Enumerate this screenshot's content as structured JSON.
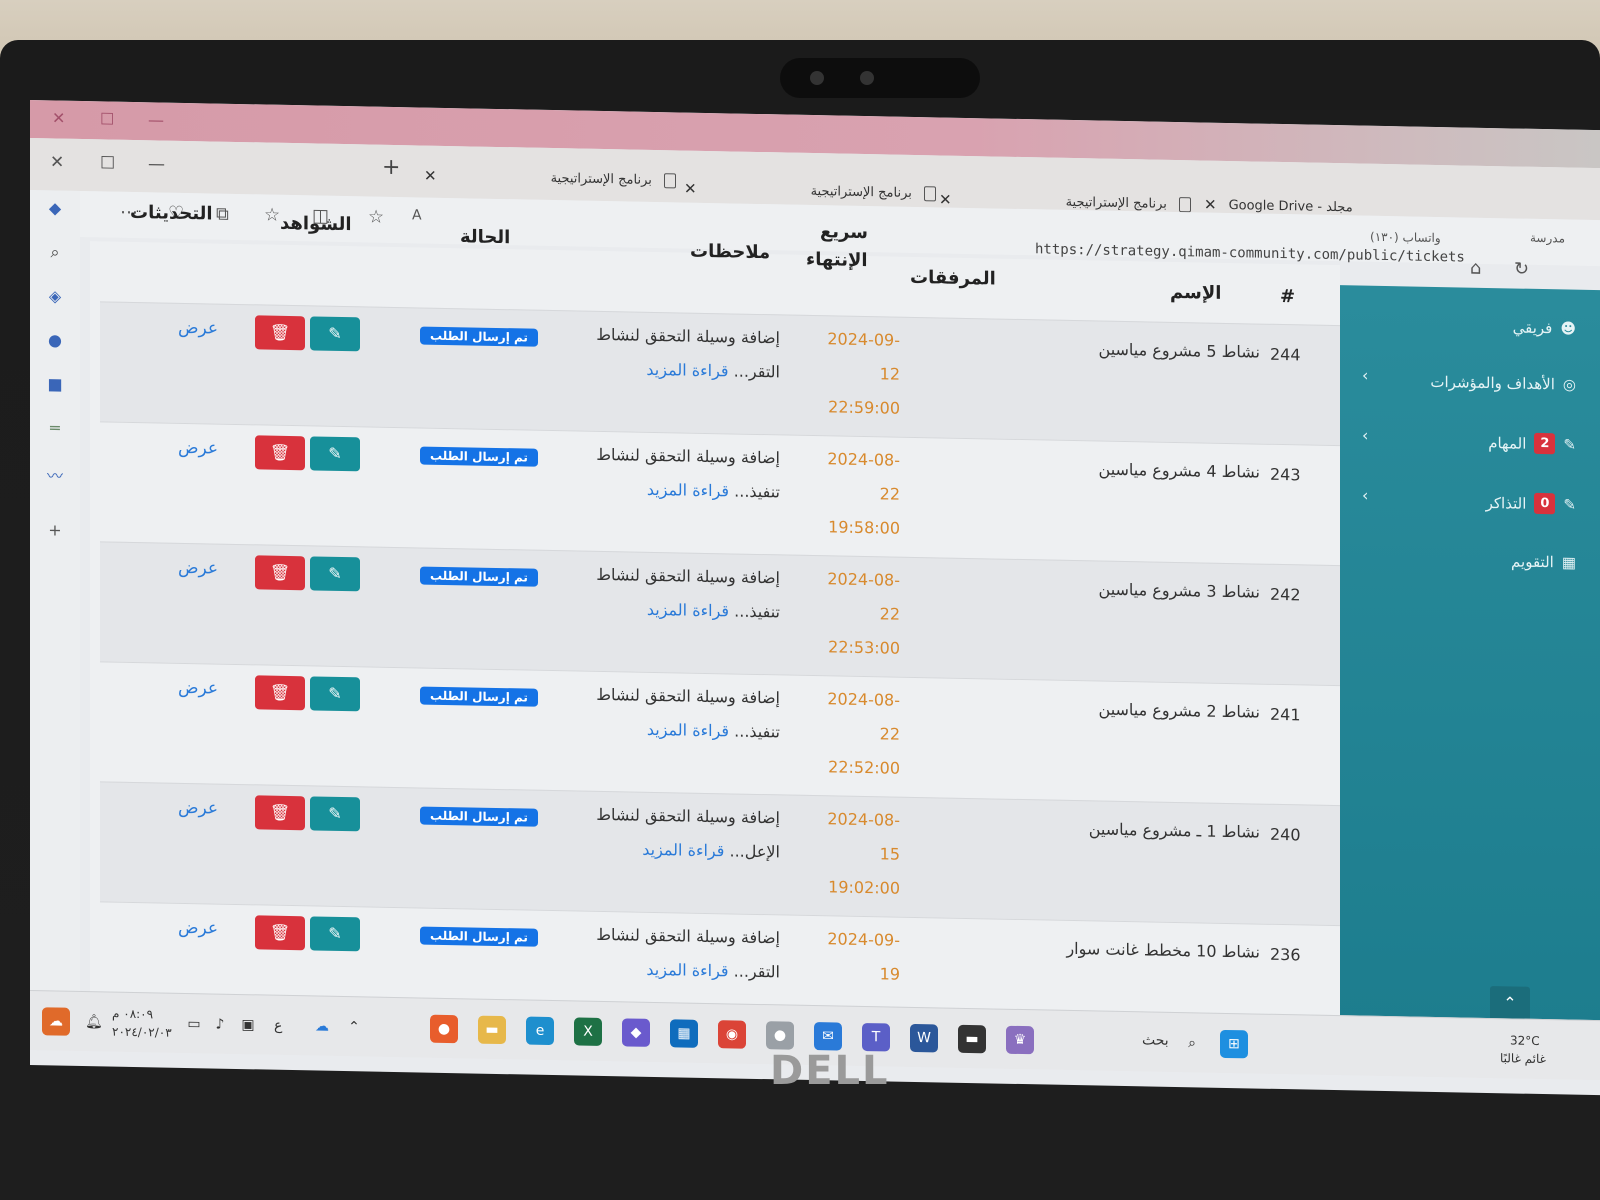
{
  "browser": {
    "tabs": [
      {
        "label": "برنامج الإستراتيجية"
      },
      {
        "label": "برنامج الإستراتيجية"
      },
      {
        "label": "برنامج الإستراتيجية"
      }
    ],
    "new_tab": "+",
    "right_tab_label": "Google Drive - مجلد",
    "whatsapp_label": "(١٣٠) واتساب",
    "school_label": "مدرسة",
    "url": "https://strategy.qimam-community.com/public/tickets"
  },
  "table": {
    "headers": {
      "number": "#",
      "name": "الإسم",
      "attachments": "المرفقات",
      "end_fast": "سريع",
      "end": "الإنتهاء",
      "notes": "ملاحظات",
      "status": "الحالة",
      "evidence": "الشواهد",
      "updates": "التحديثات"
    },
    "rows": [
      {
        "id": "244",
        "name": "نشاط 5 مشروع مياسين",
        "date": "2024-09-",
        "day": "12",
        "time": "22:59:00",
        "note": "إضافة وسيلة التحقق لنشاط",
        "note_tail": "التقر...",
        "more": "قراءة المزيد",
        "status": "تم إرسال الطلب",
        "view": "عرض"
      },
      {
        "id": "243",
        "name": "نشاط 4 مشروع مياسين",
        "date": "2024-08-",
        "day": "22",
        "time": "19:58:00",
        "note": "إضافة وسيلة التحقق لنشاط",
        "note_tail": "تنفيذ...",
        "more": "قراءة المزيد",
        "status": "تم إرسال الطلب",
        "view": "عرض"
      },
      {
        "id": "242",
        "name": "نشاط 3 مشروع مياسين",
        "date": "2024-08-",
        "day": "22",
        "time": "22:53:00",
        "note": "إضافة وسيلة التحقق لنشاط",
        "note_tail": "تنفيذ...",
        "more": "قراءة المزيد",
        "status": "تم إرسال الطلب",
        "view": "عرض"
      },
      {
        "id": "241",
        "name": "نشاط 2 مشروع مياسين",
        "date": "2024-08-",
        "day": "22",
        "time": "22:52:00",
        "note": "إضافة وسيلة التحقق لنشاط",
        "note_tail": "تنفيذ...",
        "more": "قراءة المزيد",
        "status": "تم إرسال الطلب",
        "view": "عرض"
      },
      {
        "id": "240",
        "name": "نشاط 1 ـ مشروع مياسين",
        "date": "2024-08-",
        "day": "15",
        "time": "19:02:00",
        "note": "إضافة وسيلة التحقق لنشاط",
        "note_tail": "الإعل...",
        "more": "قراءة المزيد",
        "status": "تم إرسال الطلب",
        "view": "عرض"
      },
      {
        "id": "236",
        "name": "نشاط 10 مخطط غانت سوار",
        "date": "2024-09-",
        "day": "19",
        "time": "",
        "note": "إضافة وسيلة التحقق لنشاط",
        "note_tail": "التقر...",
        "more": "قراءة المزيد",
        "status": "تم إرسال الطلب",
        "view": "عرض"
      }
    ]
  },
  "sidebar": {
    "items": [
      {
        "label": "فريقي"
      },
      {
        "label": "الأهداف والمؤشرات"
      },
      {
        "label": "المهام",
        "badge": "2"
      },
      {
        "label": "التذاكر",
        "badge": "0"
      },
      {
        "label": "التقويم"
      }
    ]
  },
  "taskbar": {
    "search": "بحث",
    "time": "٠٨:٠٩ م",
    "date": "٢٠٢٤/٠٢/٠٣",
    "lang": "ع",
    "weather_temp": "32°C",
    "weather_desc": "غائم غالبًا"
  },
  "laptop": {
    "brand": "DELL"
  },
  "colors": {
    "sidebar": "#1d7d8e",
    "badge": "#1573e6",
    "edit": "#17909a",
    "delete": "#d8323c",
    "date": "#d88a2e",
    "link": "#2a7ad8"
  }
}
